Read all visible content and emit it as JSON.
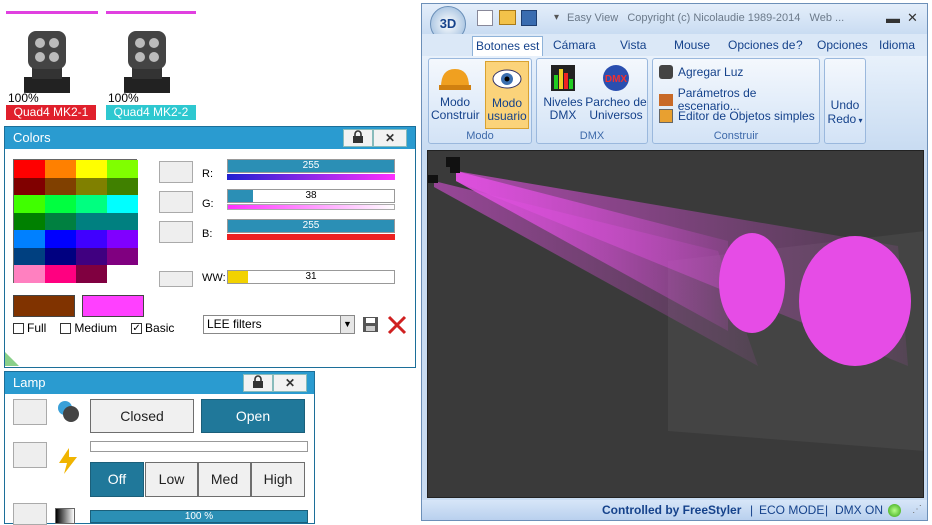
{
  "fixtures": [
    {
      "percent": "100%",
      "name": "Quad4 MK2-1",
      "tag_color": "#e0202c",
      "bar_color": "#e040e0"
    },
    {
      "percent": "100%",
      "name": "Quad4 MK2-2",
      "tag_color": "#2ec8d0",
      "bar_color": "#e040e0"
    }
  ],
  "colors_panel": {
    "title": "Colors",
    "lock_icon": "lock-icon",
    "close_label": "✕",
    "channels": [
      {
        "label": "R:",
        "value": "255",
        "level": 1.0,
        "gradient": "blue-purple"
      },
      {
        "label": "G:",
        "value": "38",
        "level": 0.15,
        "gradient": "magenta-white"
      },
      {
        "label": "B:",
        "value": "255",
        "level": 1.0,
        "gradient": "red"
      },
      {
        "label": "WW:",
        "value": "31",
        "level": 0.12,
        "gradient": "yellow"
      }
    ],
    "palette": [
      "#ff0000",
      "#ff8000",
      "#ffff00",
      "#80ff00",
      "#800000",
      "#804000",
      "#808000",
      "#408000",
      "#40ff00",
      "#00ff40",
      "#00ff80",
      "#00ffff",
      "#008000",
      "#008040",
      "#008080",
      "#008080",
      "#0080ff",
      "#0000ff",
      "#4000ff",
      "#8000ff",
      "#004080",
      "#000080",
      "#400080",
      "#800080",
      "#ff80c0",
      "#ff0080",
      "#800040",
      "#ffffff"
    ],
    "current_color": "#803300",
    "new_color": "#ff40ff",
    "checkboxes": [
      {
        "label": "Full",
        "checked": false
      },
      {
        "label": "Medium",
        "checked": false
      },
      {
        "label": "Basic",
        "checked": true
      }
    ],
    "filter_select": "LEE filters"
  },
  "lamp_panel": {
    "title": "Lamp",
    "close_label": "✕",
    "closed_label": "Closed",
    "open_label": "Open",
    "power_options": [
      "Off",
      "Low",
      "Med",
      "High"
    ],
    "active_power": "Off",
    "dimmer_label": "100 %",
    "dimmer_level": 1.0
  },
  "window": {
    "title": "Easy View   Copyright (c) Nicolaudie 1989-2014   Web ...",
    "logo": "3D",
    "tabs": [
      "Botones est",
      "Cámara",
      "Vista",
      "Mouse",
      "Opciones de",
      "?",
      "Opciones",
      "Idioma"
    ],
    "groups": {
      "modo": {
        "caption": "Modo",
        "buttons": [
          "Modo\nConstruir",
          "Modo\nusuario"
        ]
      },
      "dmx": {
        "caption": "DMX",
        "buttons": [
          "Niveles\nDMX",
          "Parcheo de\nUniversos"
        ]
      },
      "construir": {
        "caption": "Construir",
        "items": [
          "Agregar Luz",
          "Parámetros de escenario...",
          "Editor de Objetos simples"
        ]
      },
      "undo": {
        "undo": "Undo",
        "redo": "Redo"
      }
    },
    "status": {
      "controlled": "Controlled by FreeStyler",
      "eco": "ECO MODE",
      "dmx": "DMX ON"
    }
  }
}
